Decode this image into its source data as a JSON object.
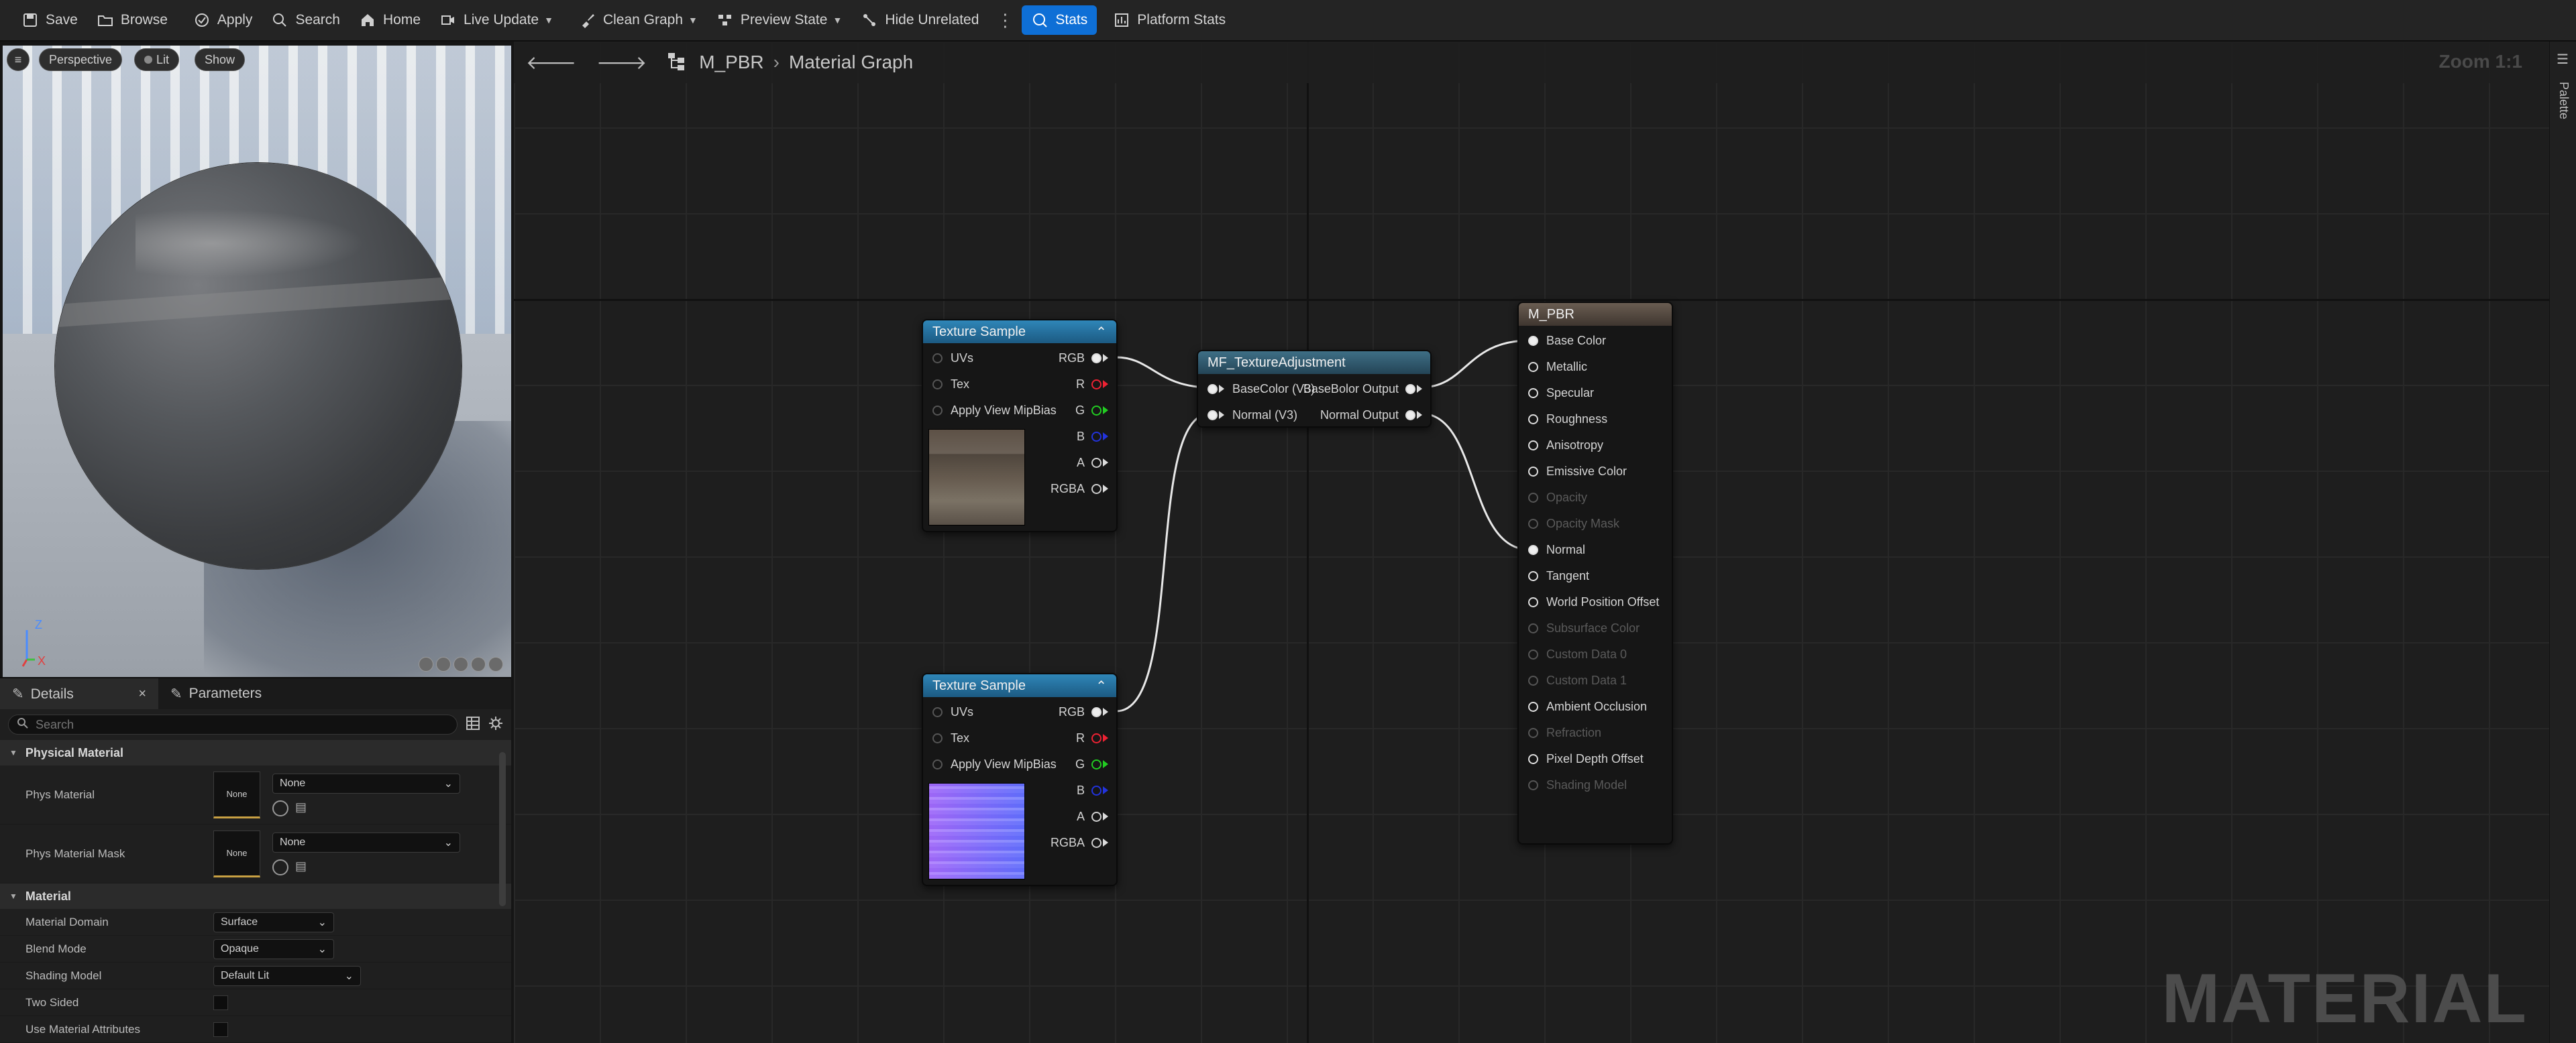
{
  "toolbar": {
    "save": "Save",
    "browse": "Browse",
    "apply": "Apply",
    "search": "Search",
    "home": "Home",
    "live_update": "Live Update",
    "clean_graph": "Clean Graph",
    "preview_state": "Preview State",
    "hide_unrelated": "Hide Unrelated",
    "stats": "Stats",
    "platform_stats": "Platform Stats"
  },
  "viewport": {
    "perspective": "Perspective",
    "lit": "Lit",
    "show": "Show",
    "axis_z": "Z",
    "axis_x": "X"
  },
  "details": {
    "tab_details": "Details",
    "tab_parameters": "Parameters",
    "search_placeholder": "Search",
    "cat_physical": "Physical Material",
    "phys_material": "Phys Material",
    "phys_material_mask": "Phys Material Mask",
    "none": "None",
    "none_combo": "None",
    "cat_material": "Material",
    "material_domain": "Material Domain",
    "material_domain_val": "Surface",
    "blend_mode": "Blend Mode",
    "blend_mode_val": "Opaque",
    "shading_model": "Shading Model",
    "shading_model_val": "Default Lit",
    "two_sided": "Two Sided",
    "use_material_attributes": "Use Material Attributes"
  },
  "graph": {
    "breadcrumb_asset": "M_PBR",
    "breadcrumb_graph": "Material Graph",
    "zoom": "Zoom 1:1",
    "palette": "Palette",
    "watermark": "MATERIAL"
  },
  "nodes": {
    "tex1": {
      "title": "Texture Sample",
      "inputs": [
        "UVs",
        "Tex",
        "Apply View MipBias"
      ],
      "outputs": [
        "RGB",
        "R",
        "G",
        "B",
        "A",
        "RGBA"
      ]
    },
    "tex2": {
      "title": "Texture Sample",
      "inputs": [
        "UVs",
        "Tex",
        "Apply View MipBias"
      ],
      "outputs": [
        "RGB",
        "R",
        "G",
        "B",
        "A",
        "RGBA"
      ]
    },
    "mf": {
      "title": "MF_TextureAdjustment",
      "in1": "BaseColor (V3)",
      "in2": "Normal (V3)",
      "out1": "BaseBolor Output",
      "out2": "Normal Output"
    },
    "mpbr": {
      "title": "M_PBR",
      "pins": [
        "Base Color",
        "Metallic",
        "Specular",
        "Roughness",
        "Anisotropy",
        "Emissive Color",
        "Opacity",
        "Opacity Mask",
        "Normal",
        "Tangent",
        "World Position Offset",
        "Subsurface Color",
        "Custom Data 0",
        "Custom Data 1",
        "Ambient Occlusion",
        "Refraction",
        "Pixel Depth Offset",
        "Shading Model"
      ]
    }
  }
}
